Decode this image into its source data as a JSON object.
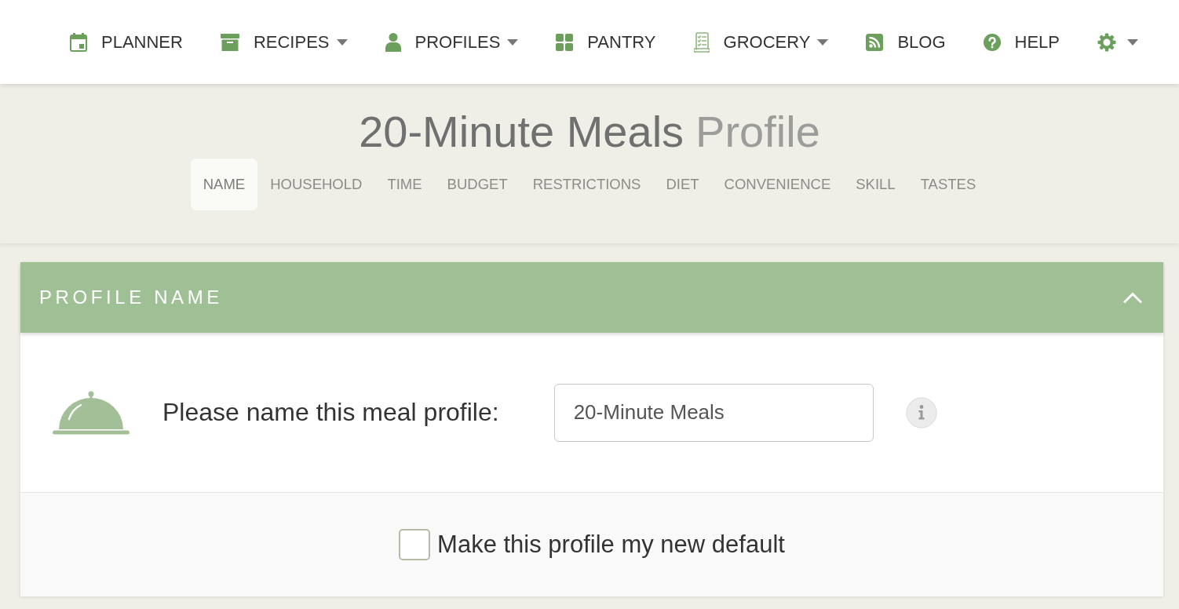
{
  "nav": {
    "items": [
      {
        "label": "PLANNER",
        "dropdown": false
      },
      {
        "label": "RECIPES",
        "dropdown": true
      },
      {
        "label": "PROFILES",
        "dropdown": true
      },
      {
        "label": "PANTRY",
        "dropdown": false
      },
      {
        "label": "GROCERY",
        "dropdown": true
      },
      {
        "label": "BLOG",
        "dropdown": false
      },
      {
        "label": "HELP",
        "dropdown": false
      }
    ],
    "settings_menu": {
      "dropdown": true
    }
  },
  "header": {
    "title": {
      "name": "20-Minute Meals",
      "suffix": "Profile"
    },
    "tabs": [
      {
        "label": "NAME",
        "selected": true
      },
      {
        "label": "HOUSEHOLD",
        "selected": false
      },
      {
        "label": "TIME",
        "selected": false
      },
      {
        "label": "BUDGET",
        "selected": false
      },
      {
        "label": "RESTRICTIONS",
        "selected": false
      },
      {
        "label": "DIET",
        "selected": false
      },
      {
        "label": "CONVENIENCE",
        "selected": false
      },
      {
        "label": "SKILL",
        "selected": false
      },
      {
        "label": "TASTES",
        "selected": false
      }
    ]
  },
  "section": {
    "title": "PROFILE NAME",
    "expanded": true,
    "field": {
      "label": "Please name this meal profile:",
      "value": "20-Minute Meals"
    },
    "default_option": {
      "label": "Make this profile my new default",
      "checked": false
    }
  }
}
